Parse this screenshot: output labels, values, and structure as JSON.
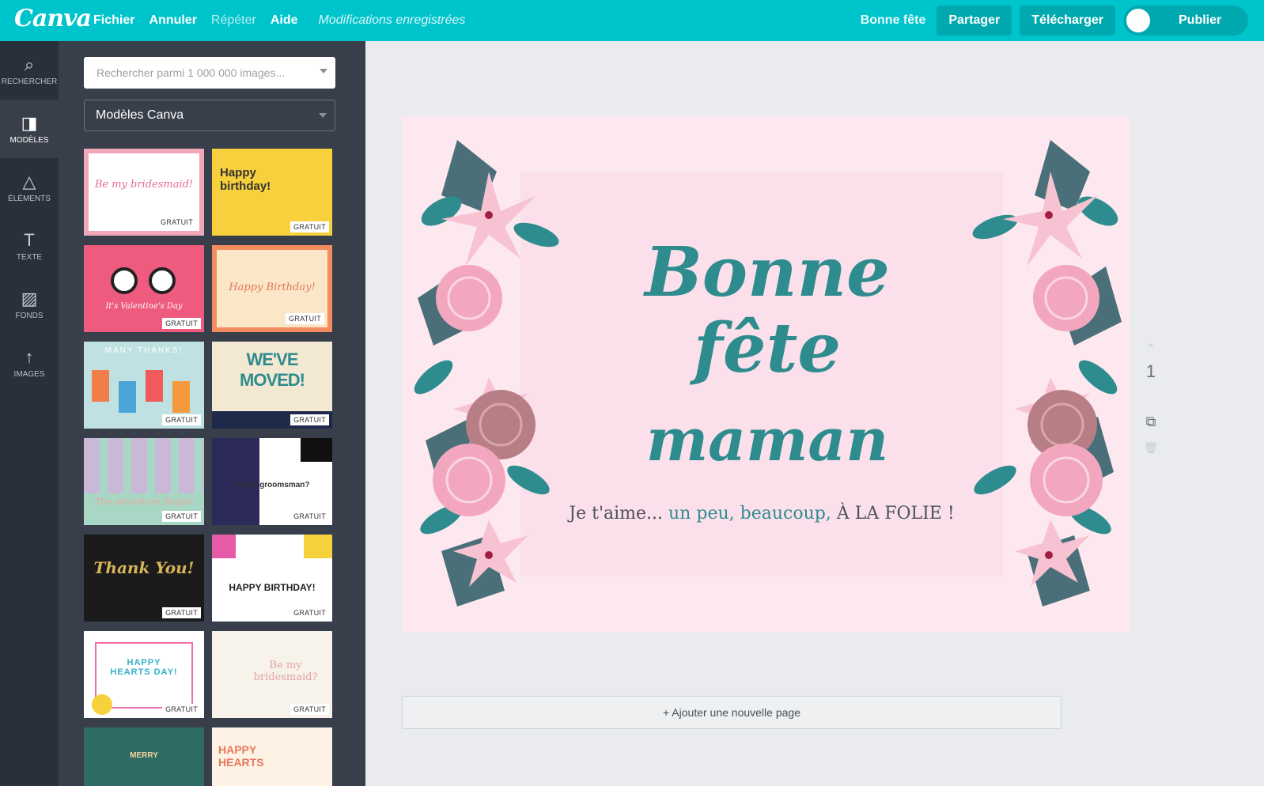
{
  "app": {
    "logo": "Canva"
  },
  "menu": {
    "file": "Fichier",
    "undo": "Annuler",
    "redo": "Répéter",
    "help": "Aide",
    "status": "Modifications enregistrées"
  },
  "header": {
    "doc_title": "Bonne fête",
    "share": "Partager",
    "download": "Télécharger",
    "publish": "Publier"
  },
  "rail": [
    {
      "label": "RECHERCHER",
      "icon": "search-icon"
    },
    {
      "label": "MODÈLES",
      "icon": "layout-icon"
    },
    {
      "label": "ÉLÉMENTS",
      "icon": "shapes-icon"
    },
    {
      "label": "TEXTE",
      "icon": "text-icon"
    },
    {
      "label": "FONDS",
      "icon": "pattern-icon"
    },
    {
      "label": "IMAGES",
      "icon": "upload-icon"
    }
  ],
  "panel": {
    "search_placeholder": "Rechercher parmi 1 000 000 images...",
    "select_value": "Modèles Canva",
    "templates": [
      {
        "text": "Be my bridesmaid!",
        "badge": "GRATUIT"
      },
      {
        "text": "Happy birthday!",
        "badge": "GRATUIT"
      },
      {
        "text": "It's Valentine's Day",
        "badge": "GRATUIT"
      },
      {
        "text": "Happy Birthday!",
        "badge": "GRATUIT"
      },
      {
        "text": "MANY THANKS!",
        "badge": "GRATUIT"
      },
      {
        "text": "WE'VE MOVED!",
        "badge": "GRATUIT"
      },
      {
        "text": "The Adventure Begins",
        "badge": "GRATUIT"
      },
      {
        "text": "be my groomsman?",
        "badge": "GRATUIT"
      },
      {
        "text": "Thank You!",
        "badge": "GRATUIT"
      },
      {
        "text": "HAPPY BIRTHDAY!",
        "badge": "GRATUIT"
      },
      {
        "text": "HAPPY HEARTS DAY!",
        "badge": "GRATUIT"
      },
      {
        "text": "Be my bridesmaid?",
        "badge": "GRATUIT"
      },
      {
        "text": "MERRY",
        "badge": ""
      },
      {
        "text": "HAPPY HEARTS",
        "badge": ""
      }
    ]
  },
  "canvas": {
    "line1": "Bonne fête",
    "line2": "maman",
    "tag_a": "Je t'aime...",
    "tag_b": "un peu, beaucoup,",
    "tag_c": "À LA FOLIE !",
    "page_number": "1",
    "add_page": "+ Ajouter une nouvelle page"
  }
}
